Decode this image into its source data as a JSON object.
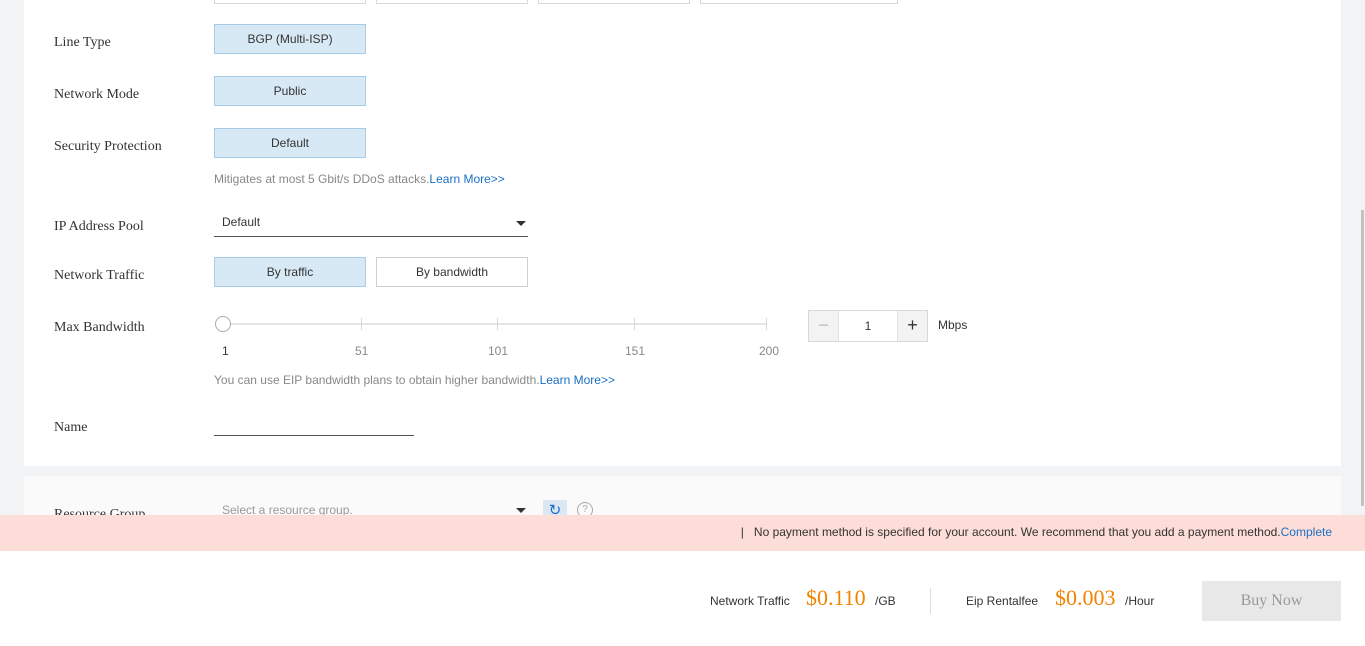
{
  "fields": {
    "line_type": {
      "label": "Line Type",
      "option": "BGP (Multi-ISP)"
    },
    "network_mode": {
      "label": "Network Mode",
      "option": "Public"
    },
    "security_protection": {
      "label": "Security Protection",
      "option": "Default",
      "hint": "Mitigates at most 5 Gbit/s DDoS attacks.",
      "link": "Learn More>>"
    },
    "ip_address_pool": {
      "label": "IP Address Pool",
      "value": "Default"
    },
    "network_traffic": {
      "label": "Network Traffic",
      "options": [
        "By traffic",
        "By bandwidth"
      ],
      "selected": "By traffic"
    },
    "max_bandwidth": {
      "label": "Max Bandwidth",
      "ticks": [
        "1",
        "51",
        "101",
        "151",
        "200"
      ],
      "value": "1",
      "unit": "Mbps",
      "minus": "−",
      "plus": "+",
      "hint": "You can use EIP bandwidth plans to obtain higher bandwidth.",
      "link": "Learn More>>"
    },
    "name": {
      "label": "Name",
      "value": ""
    },
    "resource_group": {
      "label": "Resource Group",
      "placeholder": "Select a resource group."
    }
  },
  "warning": {
    "prefix": "|   ",
    "text": "No payment method is specified for your account. We recommend that you add a payment method.",
    "link": "Complete"
  },
  "footer": {
    "traffic_label": "Network Traffic",
    "traffic_price": "$0.110",
    "traffic_unit": "/GB",
    "rental_label": "Eip Rentalfee",
    "rental_price": "$0.003",
    "rental_unit": "/Hour",
    "buy_label": "Buy Now"
  },
  "colors": {
    "accent": "#1a6fc4",
    "selected_bg": "#d8e9f6",
    "price": "#f08300",
    "warning_bg": "#fdddd8"
  },
  "icons": [
    "caret-down-icon",
    "refresh-icon",
    "help-icon",
    "minus-icon",
    "plus-icon"
  ]
}
